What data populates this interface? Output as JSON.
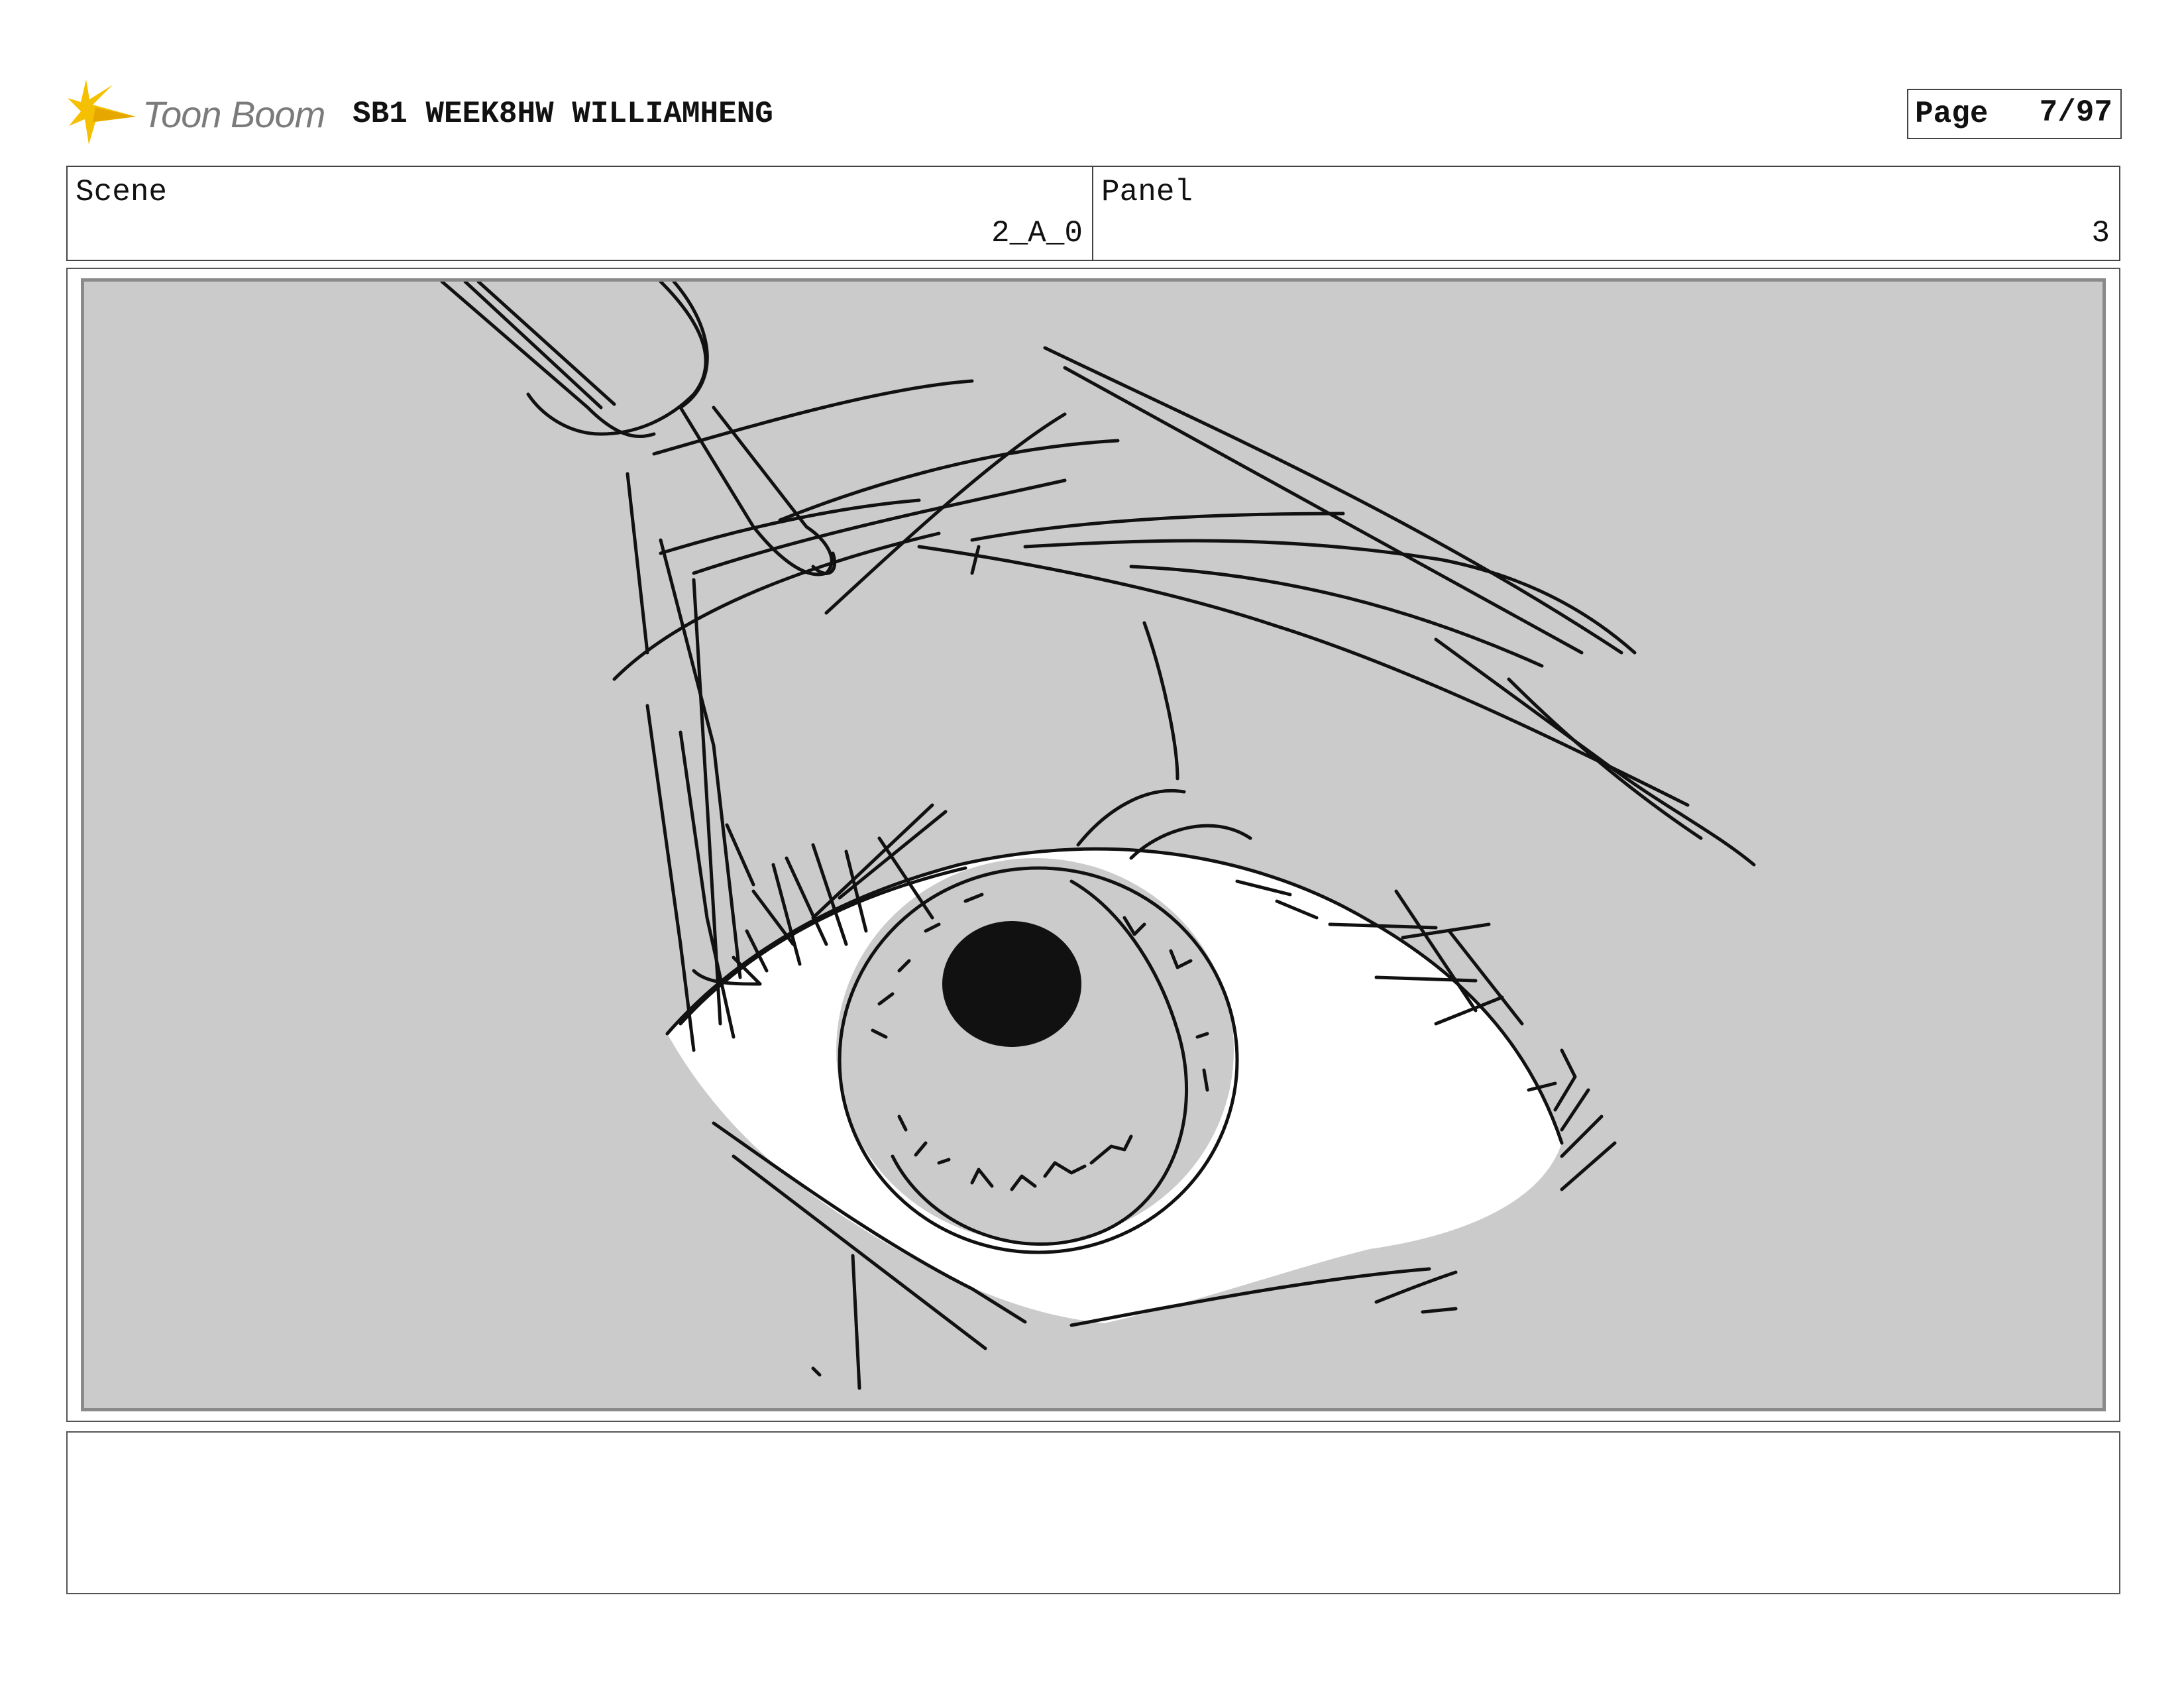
{
  "header": {
    "brand": "Toon Boom",
    "title": "SB1 WEEK8HW WILLIAMHENG",
    "page_label": "Page",
    "page_number": "7/97"
  },
  "scene": {
    "label": "Scene",
    "value": "2_A_0"
  },
  "panel": {
    "label": "Panel",
    "value": "3"
  },
  "icons": {
    "logo": "toon-boom-starburst-icon"
  },
  "colors": {
    "logo_star": "#f5c000",
    "canvas": "#cbcbcb",
    "ink": "#111111"
  }
}
